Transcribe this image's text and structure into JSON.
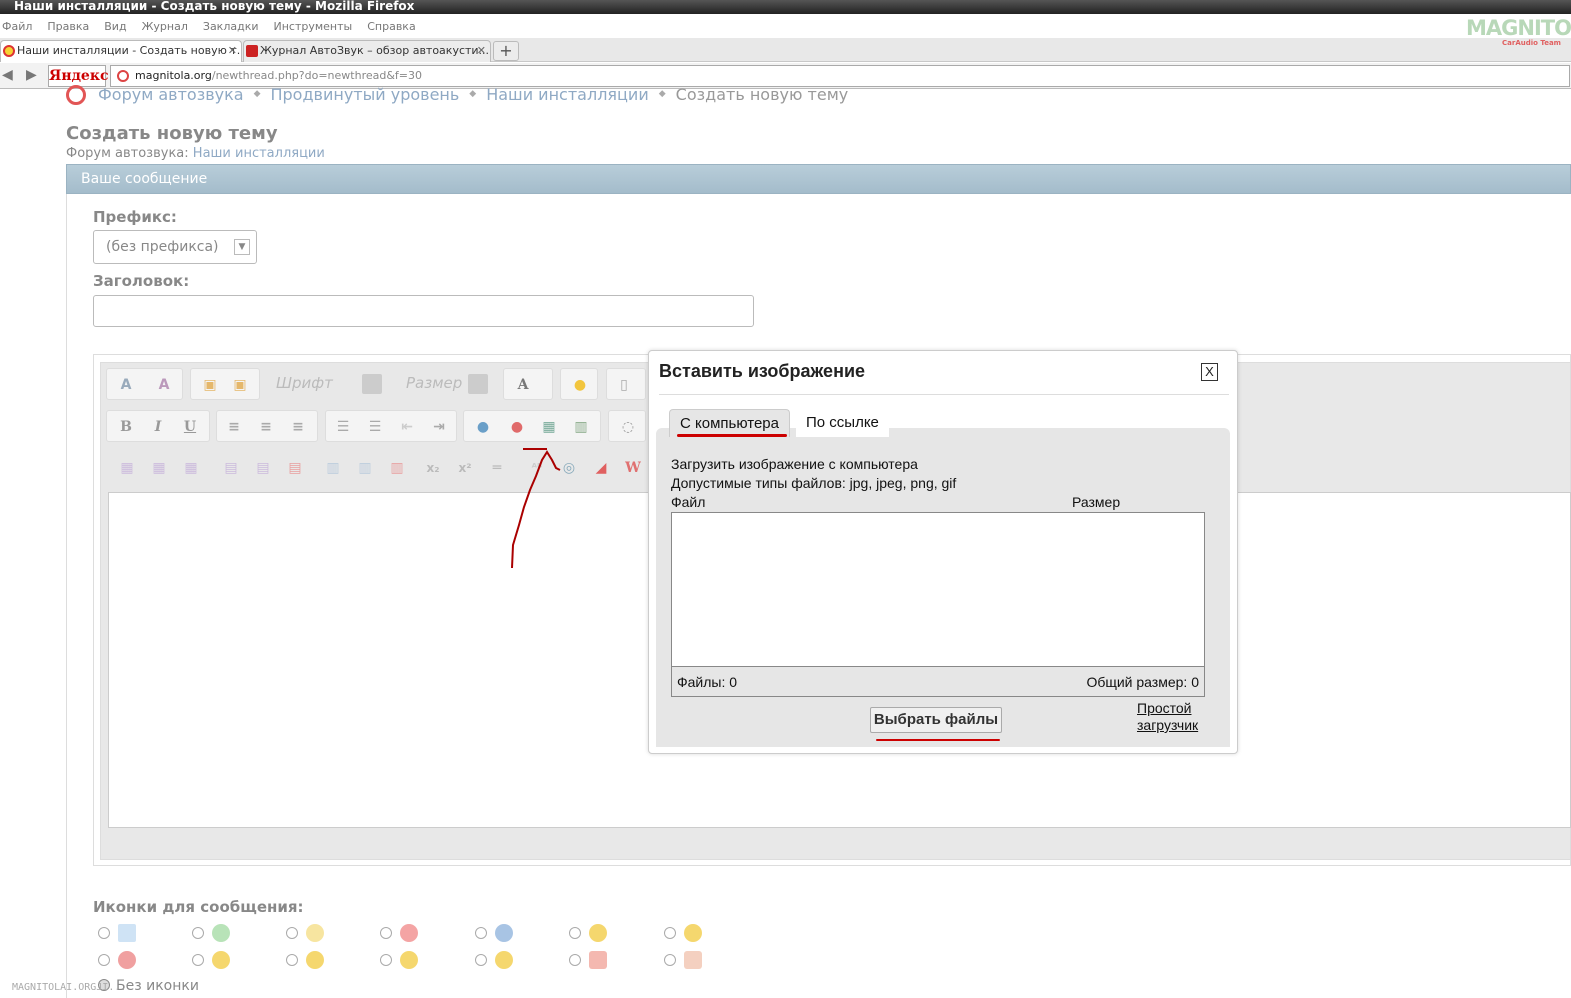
{
  "window": {
    "title": "Наши инсталляции - Создать новую тему - Mozilla Firefox"
  },
  "menu": [
    "Файл",
    "Правка",
    "Вид",
    "Журнал",
    "Закладки",
    "Инструменты",
    "Справка"
  ],
  "tabs": [
    {
      "label": "Наши инсталляции - Создать новую т...",
      "active": true
    },
    {
      "label": "Журнал АвтоЗвук – обзор автоакусти...",
      "active": false
    }
  ],
  "logo": {
    "text": "MAGNITOLA",
    "sub": "CarAudio Team"
  },
  "toolbar": {
    "yandex": "Яндекс",
    "url_host": "magnitola.org",
    "url_path": "/newthread.php?do=newthread&f=30"
  },
  "breadcrumbs": [
    "Форум автозвука",
    "Продвинутый уровень",
    "Наши инсталляции",
    "Создать новую тему"
  ],
  "page": {
    "title": "Создать новую тему",
    "forum_prefix": "Форум автозвука:",
    "forum_link": "Наши инсталляции",
    "section": "Ваше сообщение",
    "prefix_label": "Префикс:",
    "prefix_value": "(без префикса)",
    "title_label": "Заголовок:",
    "icons_label": "Иконки для сообщения:",
    "no_icon": "Без иконки"
  },
  "editor": {
    "font_placeholder": "Шрифт",
    "size_placeholder": "Размер"
  },
  "dialog": {
    "title": "Вставить изображение",
    "close": "X",
    "tab_computer": "С компьютера",
    "tab_link": "По ссылке",
    "upload_text": "Загрузить изображение с компьютера",
    "types_text": "Допустимые типы файлов: jpg, jpeg, png, gif",
    "col_file": "Файл",
    "col_size": "Размер",
    "files_count": "Файлы: 0",
    "total_size": "Общий размер: 0",
    "choose_files": "Выбрать файлы",
    "simple_loader_1": "Простой",
    "simple_loader_2": "загрузчик"
  },
  "watermark": "MAGNITOLAI.ORGJI..."
}
